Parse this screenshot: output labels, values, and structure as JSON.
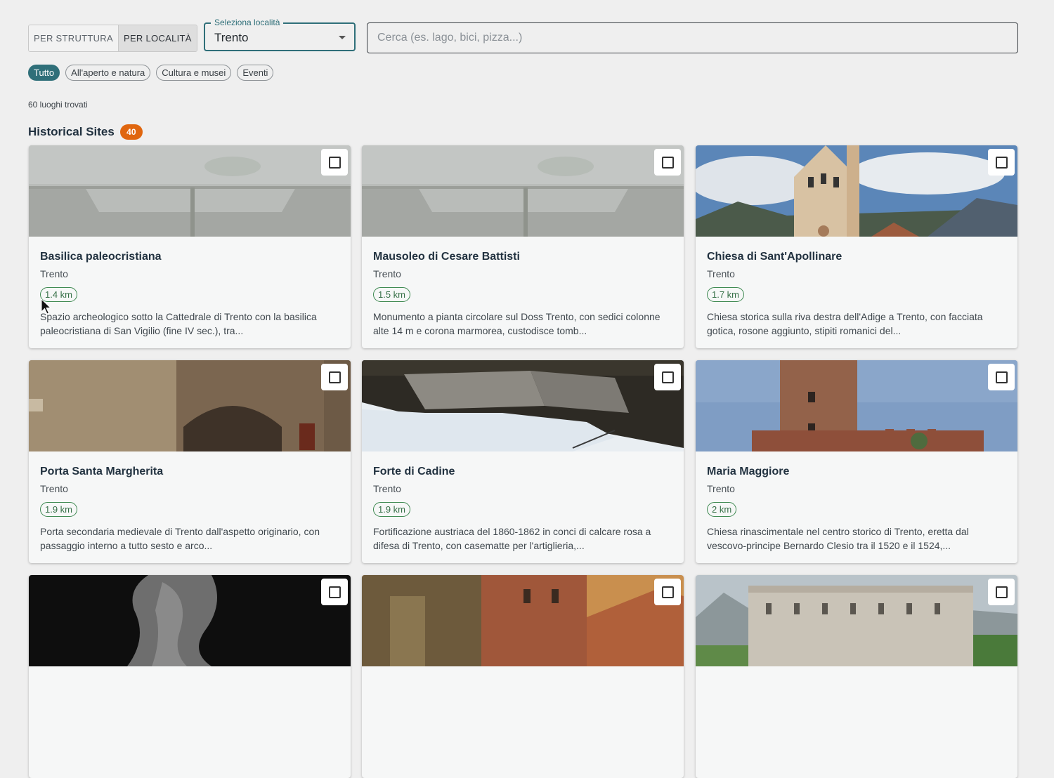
{
  "toggle": {
    "by_structure": "PER STRUTTURA",
    "by_location": "PER LOCALITÀ"
  },
  "location_select": {
    "legend": "Seleziona località",
    "value": "Trento"
  },
  "search": {
    "placeholder": "Cerca (es. lago, bici, pizza...)"
  },
  "filters": [
    "Tutto",
    "All'aperto e natura",
    "Cultura e musei",
    "Eventi"
  ],
  "results_count": "60 luoghi trovati",
  "section": {
    "title": "Historical Sites",
    "badge": "40"
  },
  "cards": [
    {
      "title": "Basilica paleocristiana",
      "location": "Trento",
      "distance": "1.4 km",
      "description": "Spazio archeologico sotto la Cattedrale di Trento con la basilica paleocristiana di San Vigilio (fine IV sec.), tra..."
    },
    {
      "title": "Mausoleo di Cesare Battisti",
      "location": "Trento",
      "distance": "1.5 km",
      "description": "Monumento a pianta circolare sul Doss Trento, con sedici colonne alte 14 m e corona marmorea, custodisce tomb..."
    },
    {
      "title": "Chiesa di Sant'Apollinare",
      "location": "Trento",
      "distance": "1.7 km",
      "description": "Chiesa storica sulla riva destra dell'Adige a Trento, con facciata gotica, rosone aggiunto, stipiti romanici del..."
    },
    {
      "title": "Porta Santa Margherita",
      "location": "Trento",
      "distance": "1.9 km",
      "description": "Porta secondaria medievale di Trento dall'aspetto originario, con passaggio interno a tutto sesto e arco..."
    },
    {
      "title": "Forte di Cadine",
      "location": "Trento",
      "distance": "1.9 km",
      "description": "Fortificazione austriaca del 1860-1862 in conci di calcare rosa a difesa di Trento, con casematte per l'artiglieria,..."
    },
    {
      "title": "Maria Maggiore",
      "location": "Trento",
      "distance": "2 km",
      "description": "Chiesa rinascimentale nel centro storico di Trento, eretta dal vescovo-principe Bernardo Clesio tra il 1520 e il 1524,..."
    },
    {
      "title": "",
      "location": "",
      "distance": "",
      "description": ""
    },
    {
      "title": "",
      "location": "",
      "distance": "",
      "description": ""
    },
    {
      "title": "",
      "location": "",
      "distance": "",
      "description": ""
    }
  ],
  "colors": {
    "accent": "#2f6f79",
    "badge": "#e0660f",
    "distance": "#3f8a52"
  }
}
